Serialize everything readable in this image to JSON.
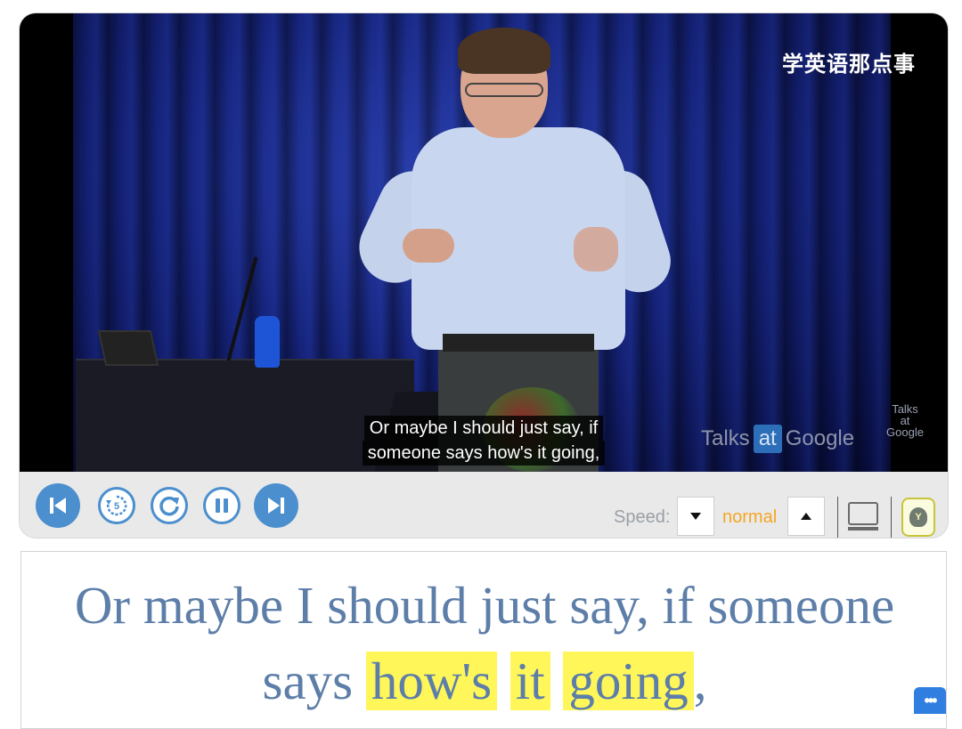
{
  "video": {
    "watermark": "学英语那点事",
    "logo_small": [
      "Talks",
      "at",
      "Google"
    ],
    "logo_main": {
      "talks": "Talks",
      "at": "at",
      "google": "Google"
    },
    "subtitle_line1": "Or maybe I should just say, if",
    "subtitle_line2": "someone says how's it going,"
  },
  "controls": {
    "buttons": [
      {
        "icon": "skip-previous-icon"
      },
      {
        "icon": "rewind-5-icon",
        "label": "5"
      },
      {
        "icon": "replay-icon"
      },
      {
        "icon": "pause-icon"
      },
      {
        "icon": "skip-next-icon"
      }
    ],
    "speed_label": "Speed:",
    "speed_value": "normal",
    "accent_color": "#4b8fce",
    "speed_color": "#f5a623"
  },
  "transcript": {
    "line1": "Or maybe I should just say, if someone",
    "says": "says",
    "word1": "how's",
    "word2": "it",
    "word3": "going",
    "trailing": ",",
    "highlight_color": "#fff65a"
  },
  "more_button": "•••"
}
